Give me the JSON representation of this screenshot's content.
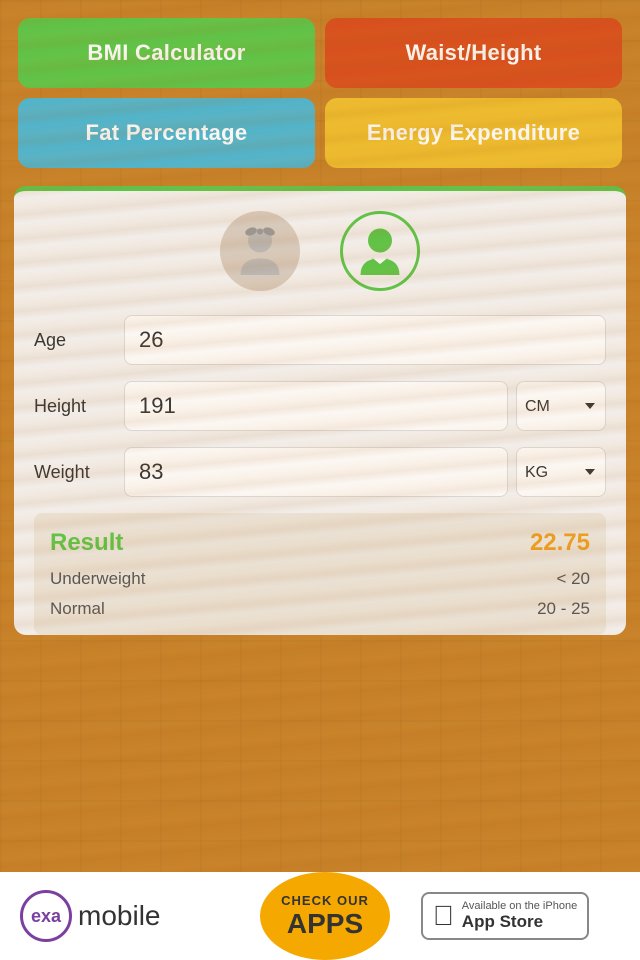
{
  "buttons": {
    "bmi": "BMI Calculator",
    "waist": "Waist/Height",
    "fat": "Fat Percentage",
    "energy": "Energy Expenditure"
  },
  "form": {
    "age_label": "Age",
    "age_value": "26",
    "height_label": "Height",
    "height_value": "191",
    "height_unit": "CM",
    "weight_label": "Weight",
    "weight_value": "83",
    "weight_unit": "KG"
  },
  "result": {
    "label": "Result",
    "value": "22.75",
    "rows": [
      {
        "label": "Underweight",
        "value": "< 20"
      },
      {
        "label": "Normal",
        "value": "20 - 25"
      }
    ]
  },
  "footer": {
    "exa": "exa",
    "mobile": "mobile",
    "check_our": "CHECK OUR",
    "apps": "APPS",
    "available": "Available on the iPhone",
    "app_store": "App Store"
  }
}
